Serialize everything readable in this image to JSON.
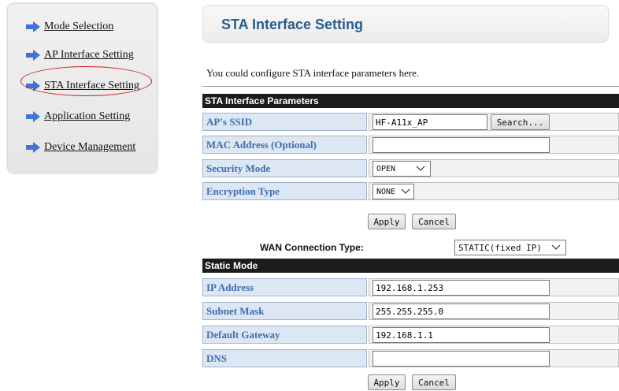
{
  "sidebar": {
    "items": [
      {
        "label": "Mode Selection"
      },
      {
        "label": "AP Interface Setting"
      },
      {
        "label": "STA Interface Setting"
      },
      {
        "label": "Application Setting"
      },
      {
        "label": "Device Management"
      }
    ],
    "arrow_color": "#3d74d6",
    "highlight_color": "#d21a1a"
  },
  "header": {
    "title": "STA Interface Setting"
  },
  "description": "You could configure STA interface parameters here.",
  "sta": {
    "section_title": "STA Interface Parameters",
    "ssid_label": "AP's SSID",
    "ssid_value": "HF-A11x_AP",
    "search_label": "Search...",
    "mac_label": "MAC Address (Optional)",
    "mac_value": "",
    "security_label": "Security Mode",
    "security_value": "OPEN",
    "encryption_label": "Encryption Type",
    "encryption_value": "NONE",
    "apply_label": "Apply",
    "cancel_label": "Cancel"
  },
  "wan": {
    "label": "WAN Connection Type:",
    "value": "STATIC(fixed IP)"
  },
  "static": {
    "section_title": "Static Mode",
    "ip_label": "IP Address",
    "ip_value": "192.168.1.253",
    "mask_label": "Subnet Mask",
    "mask_value": "255.255.255.0",
    "gateway_label": "Default Gateway",
    "gateway_value": "192.168.1.1",
    "dns_label": "DNS",
    "dns_value": "",
    "apply_label": "Apply",
    "cancel_label": "Cancel"
  }
}
